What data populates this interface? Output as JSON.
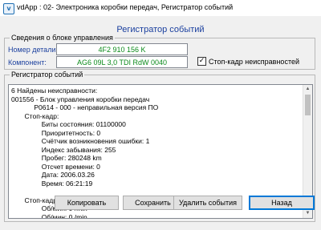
{
  "window": {
    "icon": "vcds-app-icon",
    "title": "vdApp : 02- Электроника коробки передач,  Регистратор событий"
  },
  "heading": "Регистратор событий",
  "control_unit": {
    "caption": "Сведения о блоке управления",
    "part_number_label": "Номер детали:",
    "part_number_value": "4F2 910 156 K",
    "component_label": "Компонент:",
    "component_value": "AG6 09L 3,0 TDI RdW 0040",
    "freeze_frame_label": "Стоп-кадр неисправностей",
    "freeze_frame_checked": true
  },
  "event_log": {
    "caption": "Регистратор событий",
    "lines": [
      "6 Найдены неисправности:",
      "001556 - Блок управления коробки передач",
      "            P0614 - 000 - неправильная версия ПО",
      "       Стоп-кадр:",
      "                Биты состояния: 01100000",
      "                Приоритетность: 0",
      "                Счётчик возникновения ошибки: 1",
      "                Индекс забывания: 255",
      "                Пробег: 280248 km",
      "                Отсчет времени: 0",
      "                Дата: 2006.03.26",
      "                Время: 06:21:19",
      "",
      "       Стоп-кадр:",
      "                Об/мин: 0 /min",
      "                Об/мин: 0 /min"
    ]
  },
  "buttons": {
    "copy": "Копировать",
    "save": "Сохранить",
    "delete": "Удалить события",
    "back": "Назад"
  }
}
